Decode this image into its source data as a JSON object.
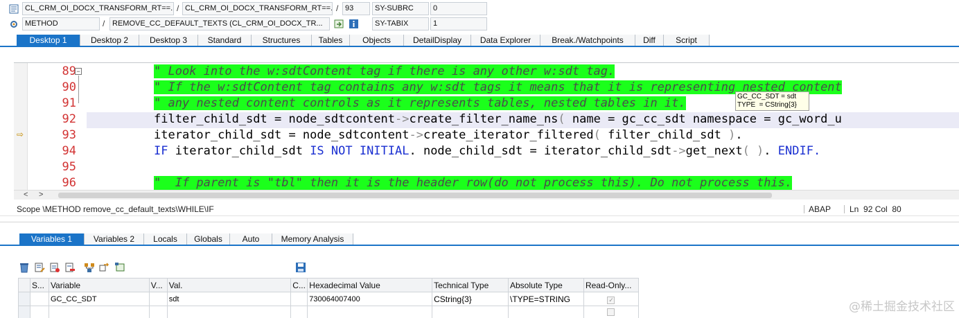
{
  "header": {
    "row1": {
      "program": "CL_CRM_OI_DOCX_TRANSFORM_RT==...",
      "include": "CL_CRM_OI_DOCX_TRANSFORM_RT==...",
      "line": "93",
      "sysvar_name": "SY-SUBRC",
      "sysvar_value": "0"
    },
    "row2": {
      "type": "METHOD",
      "event": "REMOVE_CC_DEFAULT_TEXTS (CL_CRM_OI_DOCX_TR...",
      "sysvar_name": "SY-TABIX",
      "sysvar_value": "1"
    },
    "separator": "/"
  },
  "desktop_tabs": [
    "Desktop 1",
    "Desktop 2",
    "Desktop 3",
    "Standard",
    "Structures",
    "Tables",
    "Objects",
    "DetailDisplay",
    "Data Explorer",
    "Break./Watchpoints",
    "Diff",
    "Script"
  ],
  "editor": {
    "lines": [
      {
        "num": "89",
        "text": "\" Look into the w:sdtContent tag if there is any other w:sdt tag."
      },
      {
        "num": "90",
        "text": "\" If the w:sdtContent tag contains any w:sdt tags it means that it is representing nested content"
      },
      {
        "num": "91",
        "text": "\" any nested content controls as it represents tables, nested tables in it."
      },
      {
        "num": "92",
        "parts": [
          "filter_child_sdt = node_sdtcontent",
          "->",
          "create_filter_name_ns",
          "( ",
          "name = gc_cc_sdt namespace = gc_word_u"
        ]
      },
      {
        "num": "93",
        "parts": [
          "iterator_child_sdt = node_sdtcontent",
          "->",
          "create_iterator_filtered",
          "( ",
          "filter_child_sdt ",
          ")",
          "."
        ]
      },
      {
        "num": "94",
        "parts": [
          "IF",
          " iterator_child_sdt ",
          "IS NOT INITIAL",
          ". node_child_sdt = iterator_child_sdt",
          "->",
          "get_next",
          "( ",
          ")",
          ". ",
          "ENDIF",
          "."
        ]
      },
      {
        "num": "95",
        "text": ""
      },
      {
        "num": "96",
        "text": "\"  If parent is \"tbl\" then it is the header row(do not process this). Do not process this."
      }
    ],
    "tooltip": "GC_CC_SDT = sdt\nTYPE  = CString{3}"
  },
  "status": {
    "scope": "Scope \\METHOD remove_cc_default_texts\\WHILE\\IF",
    "language": "ABAP",
    "position": "Ln  92 Col  80"
  },
  "variable_tabs": [
    "Variables 1",
    "Variables 2",
    "Locals",
    "Globals",
    "Auto",
    "Memory Analysis"
  ],
  "grid": {
    "headers": [
      "S...",
      "Variable",
      "V...",
      "Val.",
      "C...",
      "Hexadecimal Value",
      "Technical Type",
      "Absolute Type",
      "Read-Only..."
    ],
    "rows": [
      {
        "variable": "GC_CC_SDT",
        "value": "sdt",
        "hex": "730064007400",
        "tech_type": "CString{3}",
        "abs_type": "\\TYPE=STRING",
        "readonly": "✓"
      }
    ]
  },
  "watermark": "@稀土掘金技术社区",
  "colors": {
    "accent": "#1b74c8",
    "comment_highlight": "#1bff1b",
    "keyword": "#1a2fd1",
    "line_number": "#d23333"
  }
}
